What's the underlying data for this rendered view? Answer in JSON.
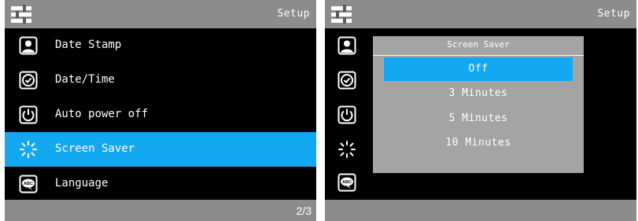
{
  "left_screen": {
    "header": {
      "title": "Setup",
      "icon": "settings-icon"
    },
    "menu": [
      {
        "label": "Date Stamp",
        "icon": "portrait-icon",
        "selected": false
      },
      {
        "label": "Date/Time",
        "icon": "clock-check-icon",
        "selected": false
      },
      {
        "label": "Auto power off",
        "icon": "power-icon",
        "selected": false
      },
      {
        "label": "Screen Saver",
        "icon": "sun-icon",
        "selected": true
      },
      {
        "label": "Language",
        "icon": "abc-language-icon",
        "selected": false
      }
    ],
    "footer": {
      "page": "2/3"
    }
  },
  "right_screen": {
    "header": {
      "title": "Setup",
      "icon": "settings-icon"
    },
    "icons": [
      "portrait-icon",
      "clock-check-icon",
      "power-icon",
      "sun-icon",
      "abc-language-icon"
    ],
    "popup": {
      "title": "Screen Saver",
      "options": [
        "Off",
        "3 Minutes",
        "5 Minutes",
        "10 Minutes"
      ],
      "selected_index": 0
    }
  },
  "colors": {
    "bar": "#8c8c8c",
    "accent": "#12a9f2",
    "background": "#000000",
    "popup": "#a4a4a4"
  }
}
